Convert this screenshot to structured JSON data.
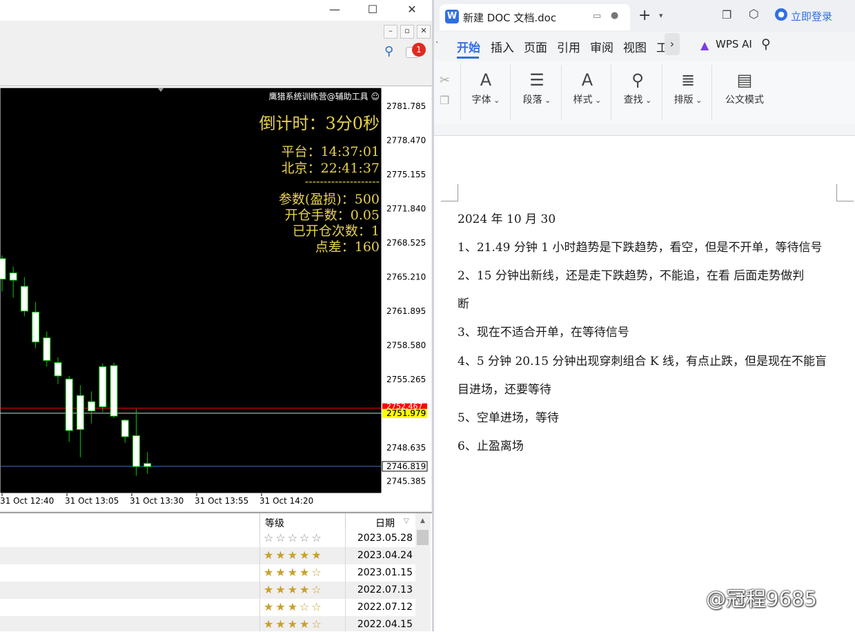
{
  "mt4": {
    "overlay": {
      "brand": "鹰猎系统训练营@辅助工具 ☺",
      "countdown_label": "倒计时：",
      "countdown_value": "3分0秒",
      "platform_label": "平台：",
      "platform_time": "14:37:01",
      "beijing_label": "北京：",
      "beijing_time": "22:41:37",
      "divider": "--------------------",
      "param_label": "参数(盈损)：",
      "param_value": "500",
      "lots_label": "开仓手数：",
      "lots_value": "0.05",
      "opened_label": "已开仓次数：",
      "opened_value": "1",
      "spread_label": "点差：",
      "spread_value": "160"
    },
    "notification_count": "1",
    "terminal": {
      "col_grade": "等级",
      "col_date": "日期",
      "rows": [
        {
          "date": "2023.05.28",
          "stars": "☆☆☆☆☆",
          "filled": 0
        },
        {
          "date": "2023.04.24",
          "stars": "★★★★★",
          "filled": 5
        },
        {
          "date": "2023.01.15",
          "stars": "★★★★☆",
          "filled": 4
        },
        {
          "date": "2022.07.13",
          "stars": "★★★★☆",
          "filled": 4
        },
        {
          "date": "2022.07.12",
          "stars": "★★★☆☆",
          "filled": 3
        },
        {
          "date": "2022.04.15",
          "stars": "★★★★☆",
          "filled": 4
        }
      ]
    }
  },
  "chart_data": {
    "type": "candlestick",
    "price_axis": [
      "2781.785",
      "2778.470",
      "2775.155",
      "2771.840",
      "2768.525",
      "2765.210",
      "2761.895",
      "2758.580",
      "2755.265",
      "2751.979",
      "2748.635",
      "2746.819",
      "2745.385"
    ],
    "time_axis": [
      "31 Oct 12:40",
      "31 Oct 13:05",
      "31 Oct 13:30",
      "31 Oct 13:55",
      "31 Oct 14:20"
    ],
    "bid_label": "2751.979",
    "ask_label": "2752.467",
    "current_line": "2746.819",
    "ylim": [
      2744.2,
      2783.6
    ],
    "colors": {
      "up": "#ffffff",
      "down": "#ffffff",
      "wick": "#00c800",
      "ask": "#ff0000",
      "bid": "#ffff00"
    },
    "candles": [
      {
        "o": 2765.0,
        "h": 2767.3,
        "l": 2763.8,
        "c": 2767.0
      },
      {
        "o": 2765.6,
        "h": 2766.2,
        "l": 2763.2,
        "c": 2764.9
      },
      {
        "o": 2764.3,
        "h": 2765.2,
        "l": 2761.4,
        "c": 2761.9
      },
      {
        "o": 2761.8,
        "h": 2762.8,
        "l": 2758.3,
        "c": 2758.9
      },
      {
        "o": 2759.3,
        "h": 2759.9,
        "l": 2756.5,
        "c": 2757.1
      },
      {
        "o": 2756.9,
        "h": 2757.4,
        "l": 2754.8,
        "c": 2755.6
      },
      {
        "o": 2755.3,
        "h": 2755.6,
        "l": 2749.2,
        "c": 2750.3
      },
      {
        "o": 2750.4,
        "h": 2754.7,
        "l": 2747.7,
        "c": 2753.7
      },
      {
        "o": 2752.2,
        "h": 2754.1,
        "l": 2751.0,
        "c": 2753.1
      },
      {
        "o": 2752.6,
        "h": 2756.8,
        "l": 2752.1,
        "c": 2756.5
      },
      {
        "o": 2756.6,
        "h": 2756.9,
        "l": 2751.5,
        "c": 2751.7
      },
      {
        "o": 2751.3,
        "h": 2751.4,
        "l": 2749.1,
        "c": 2749.7
      },
      {
        "o": 2749.8,
        "h": 2752.4,
        "l": 2745.9,
        "c": 2746.8
      },
      {
        "o": 2746.8,
        "h": 2748.2,
        "l": 2746.1,
        "c": 2747.1
      }
    ]
  },
  "wps": {
    "tab_title": "新建 DOC 文档.doc",
    "login": "立即登录",
    "menu": [
      "开始",
      "插入",
      "页面",
      "引用",
      "审阅",
      "视图",
      "工"
    ],
    "wps_ai": "WPS AI",
    "ribbon": [
      {
        "label": "字体",
        "icon": "A"
      },
      {
        "label": "段落",
        "icon": "☰"
      },
      {
        "label": "样式",
        "icon": "A"
      },
      {
        "label": "查找",
        "icon": "⚲"
      },
      {
        "label": "排版",
        "icon": "≣"
      },
      {
        "label": "公文模式",
        "icon": "▤"
      }
    ],
    "doc_lines": [
      "2024 年 10 月 30",
      "1、21.49 分钟 1 小时趋势是下跌趋势，看空，但是不开单，等待信号",
      "2、15 分钟出新线，还是走下跌趋势，不能追，在看  后面走势做判",
      "断",
      "3、现在不适合开单，在等待信号",
      "4、5 分钟 20.15 分钟出现穿刺组合 K 线，有点止跌，但是现在不能盲",
      "目进场，还要等待",
      "5、空单进场，等待",
      "6、止盈离场"
    ],
    "watermark": "@冠程9685"
  }
}
